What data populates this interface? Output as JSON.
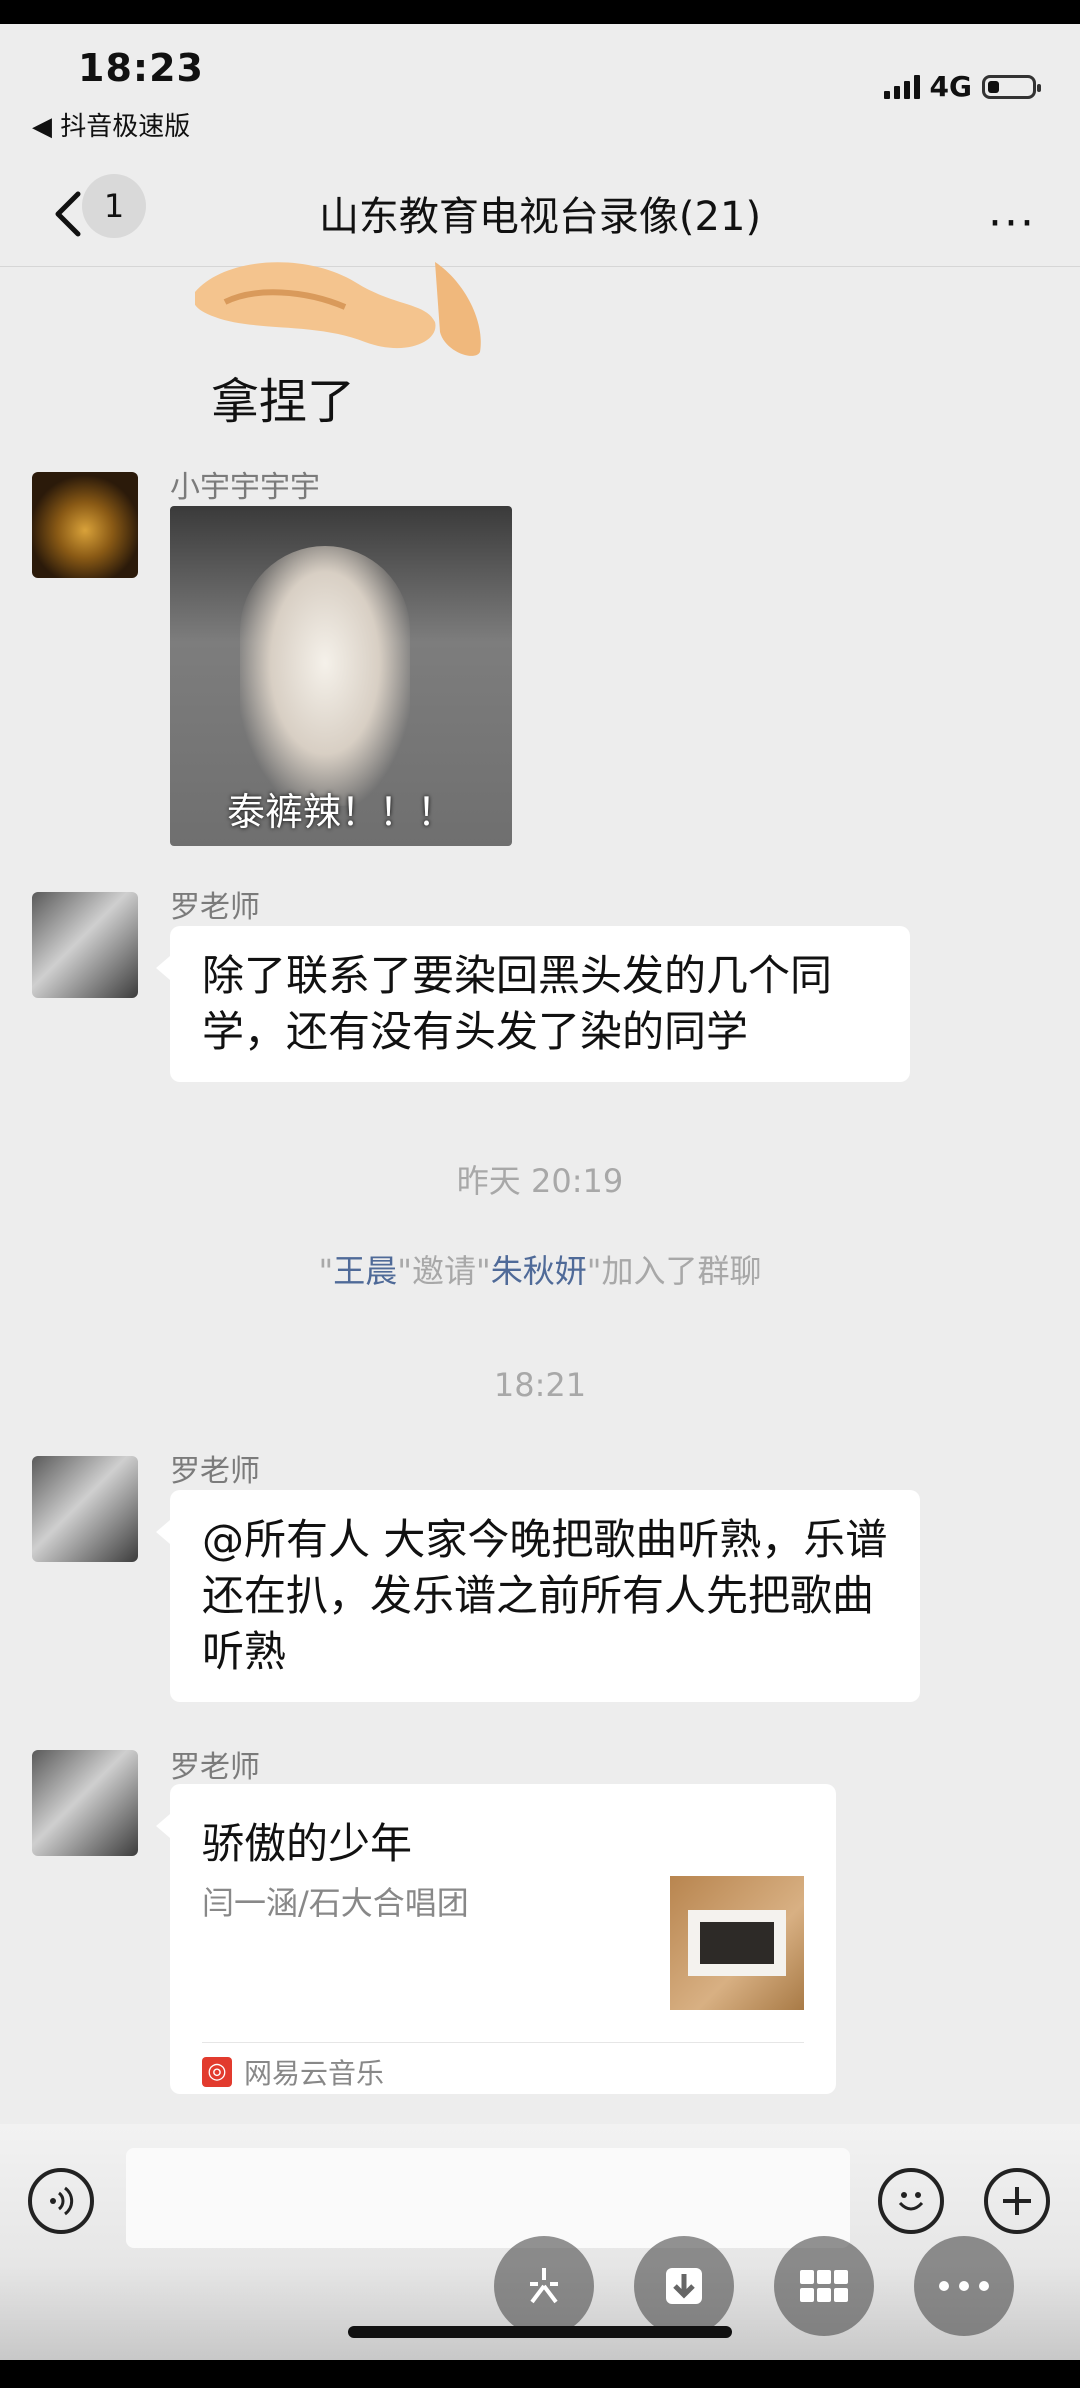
{
  "status_bar": {
    "time": "18:23",
    "back_app": "◀ 抖音极速版",
    "network": "4G",
    "battery_fraction": 0.25
  },
  "nav": {
    "unread_count": "1",
    "title": "山东教育电视台录像(21)",
    "more": "···"
  },
  "messages": {
    "top_sticker_caption": "拿捏了",
    "m1": {
      "sender": "小宇宇宇宇",
      "sticker_caption": "泰裤辣！！！"
    },
    "m2": {
      "sender": "罗老师",
      "text": "除了联系了要染回黑头发的几个同学，还有没有头发了染的同学"
    },
    "time1": "昨天 20:19",
    "system": {
      "q1": "\"",
      "inviter": "王晨",
      "mid": "\"邀请\"",
      "invitee": "朱秋妍",
      "tail": "\"加入了群聊"
    },
    "time2": "18:21",
    "m3": {
      "sender": "罗老师",
      "text": "@所有人 大家今晚把歌曲听熟，乐谱还在扒，发乐谱之前所有人先把歌曲听熟"
    },
    "m4": {
      "sender": "罗老师",
      "card_title": "骄傲的少年",
      "card_subtitle": "闫一涵/石大合唱团",
      "card_source": "网易云音乐"
    }
  },
  "icons": [
    "voice-icon",
    "emoji-icon",
    "plus-icon",
    "sparkle-icon",
    "download-icon",
    "grid-icon",
    "more-icon"
  ]
}
